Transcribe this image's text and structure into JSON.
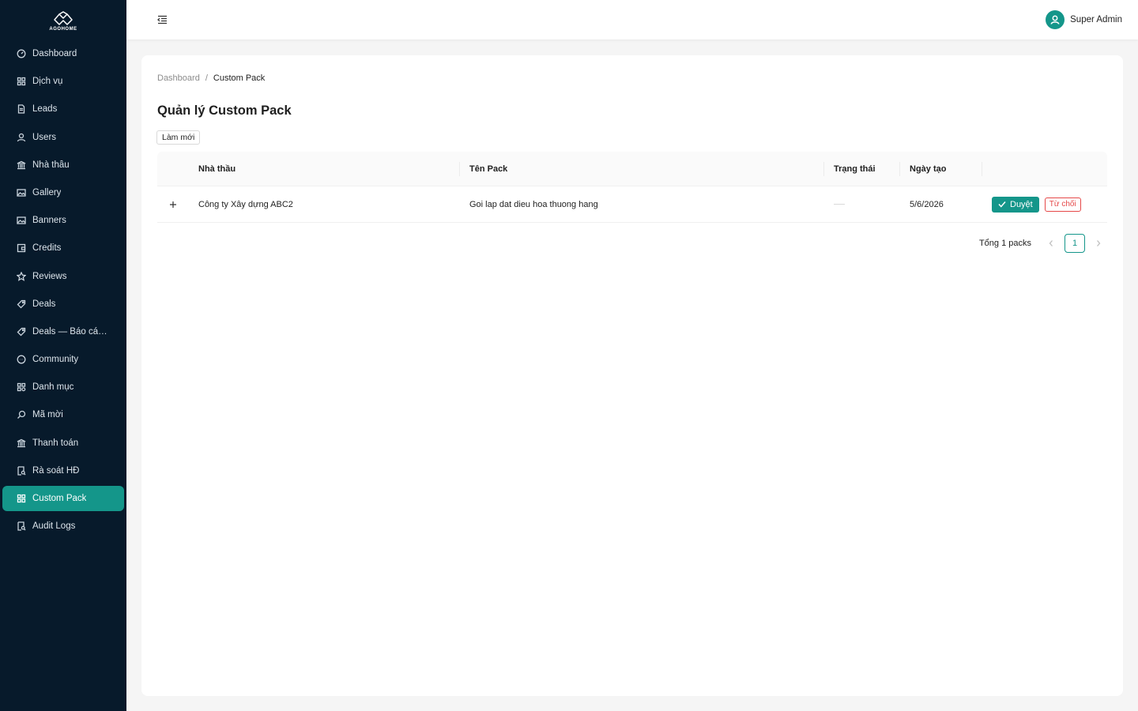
{
  "brand": {
    "name": "AGOHOME"
  },
  "sidebar": {
    "items": [
      {
        "label": "Dashboard",
        "icon": "dashboard-icon"
      },
      {
        "label": "Dịch vụ",
        "icon": "grid-icon"
      },
      {
        "label": "Leads",
        "icon": "file-icon"
      },
      {
        "label": "Users",
        "icon": "user-icon"
      },
      {
        "label": "Nhà thầu",
        "icon": "bank-icon"
      },
      {
        "label": "Gallery",
        "icon": "image-icon"
      },
      {
        "label": "Banners",
        "icon": "image-icon"
      },
      {
        "label": "Credits",
        "icon": "wallet-icon"
      },
      {
        "label": "Reviews",
        "icon": "star-icon"
      },
      {
        "label": "Deals",
        "icon": "tag-icon"
      },
      {
        "label": "Deals — Báo cáo vi phạm",
        "icon": "tag-icon"
      },
      {
        "label": "Community",
        "icon": "message-icon"
      },
      {
        "label": "Danh mục",
        "icon": "category-icon"
      },
      {
        "label": "Mã mời",
        "icon": "search-icon"
      },
      {
        "label": "Thanh toán",
        "icon": "bank-icon"
      },
      {
        "label": "Rà soát HĐ",
        "icon": "audit-icon"
      },
      {
        "label": "Custom Pack",
        "icon": "grid-icon",
        "active": true
      },
      {
        "label": "Audit Logs",
        "icon": "audit-icon"
      }
    ]
  },
  "header": {
    "user_name": "Super Admin"
  },
  "breadcrumb": {
    "home": "Dashboard",
    "separator": "/",
    "current": "Custom Pack"
  },
  "page": {
    "title": "Quản lý Custom Pack",
    "refresh_label": "Làm mới"
  },
  "table": {
    "columns": [
      "Nhà thầu",
      "Tên Pack",
      "Trạng thái",
      "Ngày tạo"
    ],
    "rows": [
      {
        "contractor": "Công ty Xây dựng ABC2",
        "pack_name": "Goi lap dat dieu hoa thuong hang",
        "status": "",
        "created": "5/6/2026",
        "approve_label": "Duyệt",
        "reject_label": "Từ chối"
      }
    ]
  },
  "pagination": {
    "total_text": "Tổng 1 packs",
    "current_page": "1"
  },
  "colors": {
    "sidebar_bg": "#071a2b",
    "accent": "#14968a",
    "danger": "#e54848"
  }
}
